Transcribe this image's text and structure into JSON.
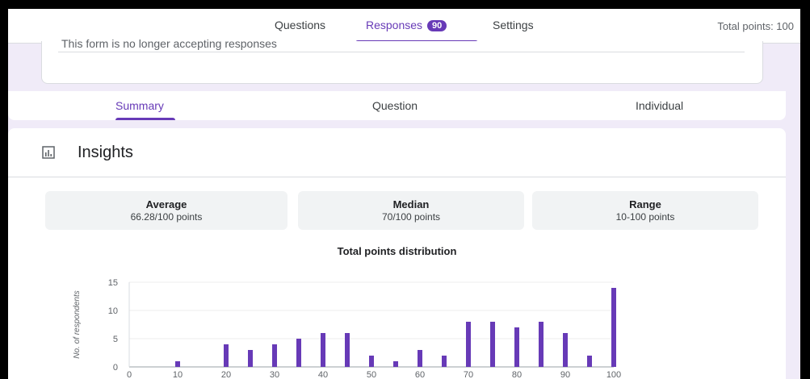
{
  "top_nav": {
    "tabs": [
      {
        "label": "Questions"
      },
      {
        "label": "Responses",
        "badge": "90"
      },
      {
        "label": "Settings"
      }
    ],
    "total_points": "Total points: 100"
  },
  "notice": "This form is no longer accepting responses",
  "sub_tabs": [
    "Summary",
    "Question",
    "Individual"
  ],
  "insights": {
    "title": "Insights",
    "stats": [
      {
        "label": "Average",
        "value": "66.28/100 points"
      },
      {
        "label": "Median",
        "value": "70/100 points"
      },
      {
        "label": "Range",
        "value": "10-100 points"
      }
    ]
  },
  "colors": {
    "accent": "#673ab7",
    "bar": "#673ab7",
    "background": "#f0ebf8"
  },
  "chart_data": {
    "type": "bar",
    "title": "Total points distribution",
    "ylabel": "No. of respondents",
    "xlabel": "",
    "x": [
      10,
      20,
      25,
      30,
      35,
      40,
      45,
      50,
      55,
      60,
      65,
      70,
      75,
      80,
      85,
      90,
      95,
      100
    ],
    "values": [
      1,
      4,
      3,
      4,
      5,
      6,
      6,
      2,
      1,
      3,
      2,
      8,
      8,
      7,
      8,
      6,
      2,
      14
    ],
    "xlim": [
      0,
      100
    ],
    "ylim": [
      0,
      15
    ],
    "xticks": [
      0,
      10,
      20,
      30,
      40,
      50,
      60,
      70,
      80,
      90,
      100
    ],
    "yticks": [
      0,
      5,
      10,
      15
    ],
    "grid": true
  }
}
